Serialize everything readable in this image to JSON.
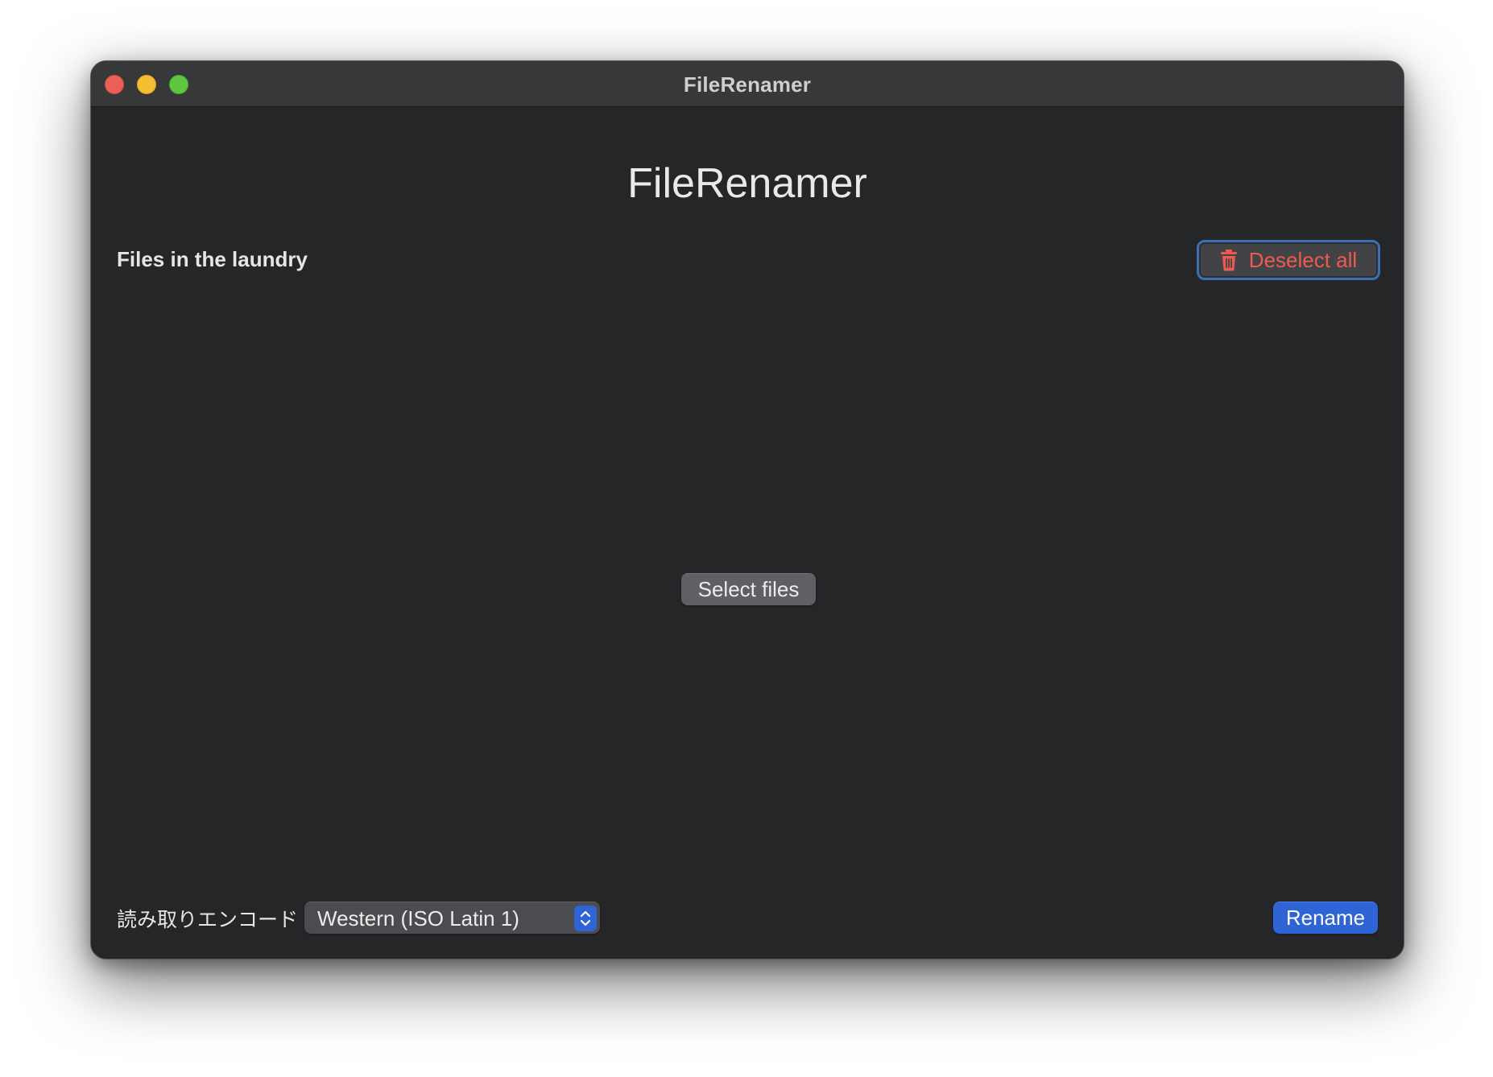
{
  "window": {
    "title": "FileRenamer"
  },
  "main": {
    "heading": "FileRenamer",
    "section_label": "Files in the laundry",
    "deselect_all_label": "Deselect all",
    "select_files_label": "Select files"
  },
  "footer": {
    "encoding_label": "読み取りエンコード",
    "encoding_value": "Western (ISO Latin 1)",
    "rename_label": "Rename"
  },
  "icons": {
    "trash": "trash-icon",
    "stepper": "chevron-up-down-icon"
  },
  "colors": {
    "accent": "#2f64d6",
    "destructive": "#ee5a4f",
    "window_bg": "#252628",
    "titlebar_bg": "#37383a",
    "close": "#ec5f57",
    "minimize": "#f4be30",
    "zoom": "#5fc73f"
  }
}
